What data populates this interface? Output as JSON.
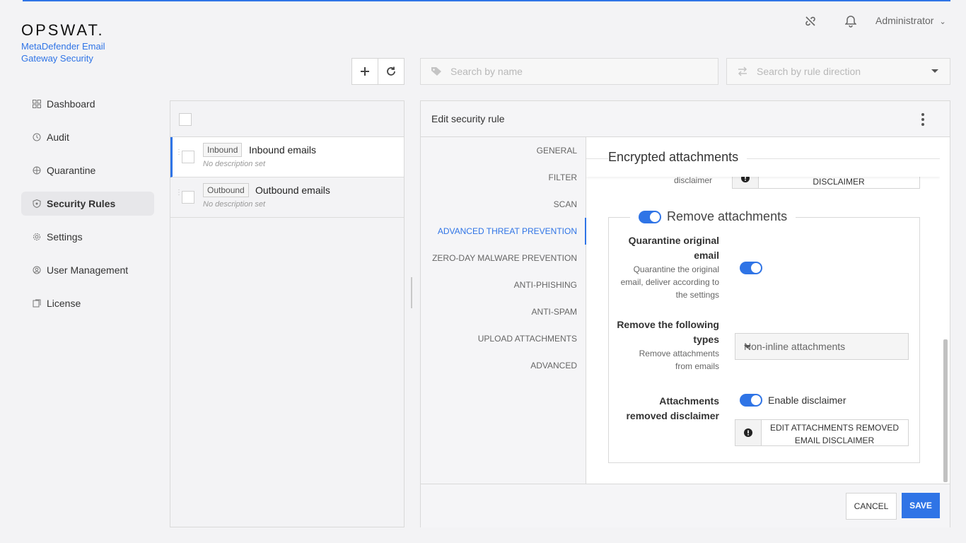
{
  "brand": {
    "logo": "OPSWAT.",
    "product": "MetaDefender Email Gateway Security",
    "accent": "#2f74e6"
  },
  "header": {
    "icons": [
      "link-off-icon",
      "bell-icon"
    ],
    "user": "Administrator"
  },
  "sidebar": {
    "items": [
      {
        "label": "Dashboard",
        "icon": "dashboard-icon",
        "active": false
      },
      {
        "label": "Audit",
        "icon": "audit-icon",
        "active": false
      },
      {
        "label": "Quarantine",
        "icon": "quarantine-icon",
        "active": false
      },
      {
        "label": "Security Rules",
        "icon": "shield-icon",
        "active": true
      },
      {
        "label": "Settings",
        "icon": "gear-icon",
        "active": false
      },
      {
        "label": "User Management",
        "icon": "user-management-icon",
        "active": false
      },
      {
        "label": "License",
        "icon": "license-icon",
        "active": false
      }
    ]
  },
  "toolbar": {
    "add_icon": "plus-icon",
    "refresh_icon": "refresh-icon",
    "search_name_placeholder": "Search by name",
    "search_direction_placeholder": "Search by rule direction"
  },
  "rules": [
    {
      "tag": "Inbound",
      "name": "Inbound emails",
      "description": "No description set",
      "active": true
    },
    {
      "tag": "Outbound",
      "name": "Outbound emails",
      "description": "No description set",
      "active": false
    }
  ],
  "editor": {
    "title": "Edit security rule",
    "tabs": [
      {
        "label": "GENERAL",
        "active": false
      },
      {
        "label": "FILTER",
        "active": false
      },
      {
        "label": "SCAN",
        "active": false
      },
      {
        "label": "ADVANCED THREAT PREVENTION",
        "active": true
      },
      {
        "label": "ZERO-DAY MALWARE PREVENTION",
        "active": false
      },
      {
        "label": "ANTI-PHISHING",
        "active": false
      },
      {
        "label": "ANTI-SPAM",
        "active": false
      },
      {
        "label": "UPLOAD ATTACHMENTS",
        "active": false
      },
      {
        "label": "ADVANCED",
        "active": false
      }
    ],
    "section_title": "Encrypted attachments",
    "cut_off_label": "disclaimer",
    "cut_off_button": "DISCLAIMER",
    "remove_attachments": {
      "title": "Remove attachments",
      "enabled": true,
      "quarantine_label": "Quarantine original email",
      "quarantine_help": "Quarantine the original email, deliver according to the settings",
      "quarantine_enabled": true,
      "types_label": "Remove the following types",
      "types_help": "Remove attachments from emails",
      "types_value": "Non-inline attachments",
      "disclaimer_label": "Attachments removed disclaimer",
      "disclaimer_toggle_label": "Enable disclaimer",
      "disclaimer_enabled": true,
      "disclaimer_button": "EDIT ATTACHMENTS REMOVED EMAIL DISCLAIMER"
    },
    "cancel": "CANCEL",
    "save": "SAVE"
  }
}
